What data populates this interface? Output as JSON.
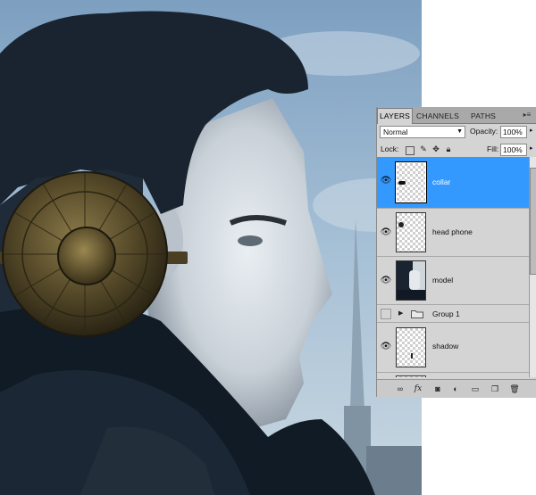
{
  "tabs": [
    "LAYERS",
    "CHANNELS",
    "PATHS"
  ],
  "blend_mode": "Normal",
  "opacity_label": "Opacity:",
  "opacity_value": "100%",
  "lock_label": "Lock:",
  "fill_label": "Fill:",
  "fill_value": "100%",
  "layers": [
    {
      "name": "collar",
      "visible": true,
      "selected": true
    },
    {
      "name": "head phone",
      "visible": true,
      "selected": false
    },
    {
      "name": "model",
      "visible": true,
      "selected": false
    },
    {
      "name": "Group 1",
      "visible": false,
      "selected": false,
      "type": "group"
    },
    {
      "name": "shadow",
      "visible": true,
      "selected": false
    }
  ],
  "icons": {
    "eye": "eye-icon",
    "panel_menu": "panel-menu-icon",
    "footer": [
      "link-layers-icon",
      "fx-icon",
      "mask-icon",
      "adjustment-icon",
      "new-group-icon",
      "new-layer-icon",
      "trash-icon"
    ],
    "locks": [
      "lock-transparent-icon",
      "lock-brush-icon",
      "lock-move-icon",
      "lock-all-icon"
    ]
  },
  "colors": {
    "selection": "#3399ff",
    "panel": "#d4d4d4",
    "sky": "#8fb1cf"
  }
}
